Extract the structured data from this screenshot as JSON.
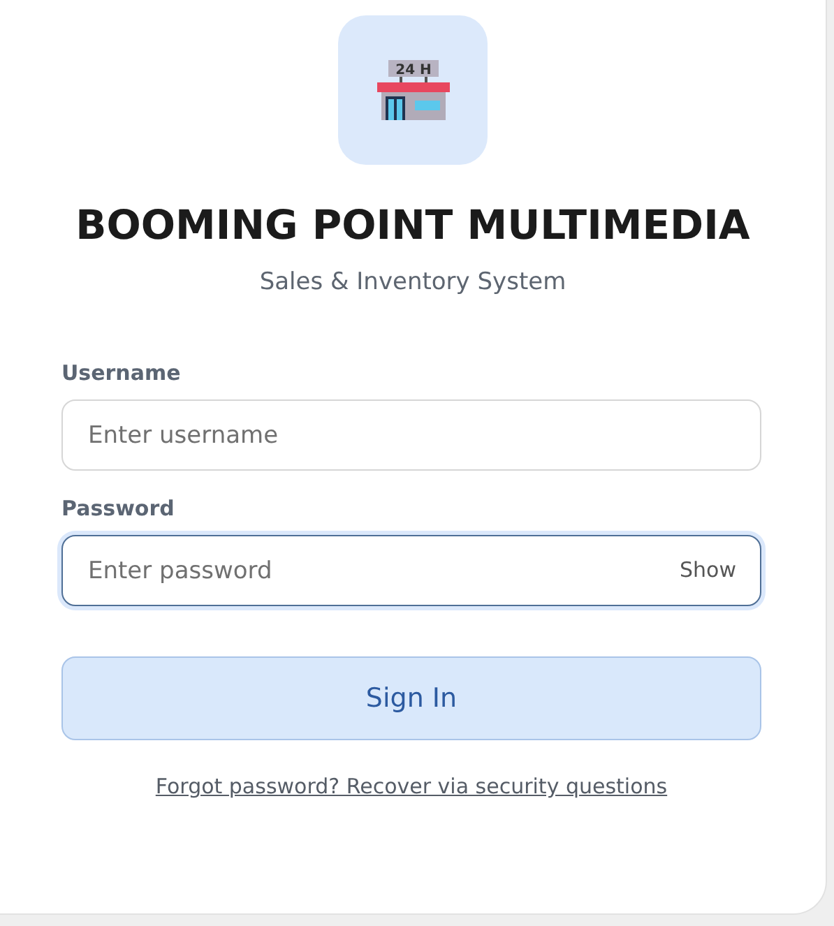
{
  "logo": {
    "sign": "24 H"
  },
  "title": "BOOMING POINT MULTIMEDIA",
  "subtitle": "Sales & Inventory System",
  "fields": [
    {
      "label": "Username",
      "placeholder": "Enter username",
      "focused": false
    },
    {
      "label": "Password",
      "placeholder": "Enter password",
      "focused": true,
      "toggle": "Show"
    }
  ],
  "submit": "Sign In",
  "link": "Forgot password? Recover via security questions"
}
